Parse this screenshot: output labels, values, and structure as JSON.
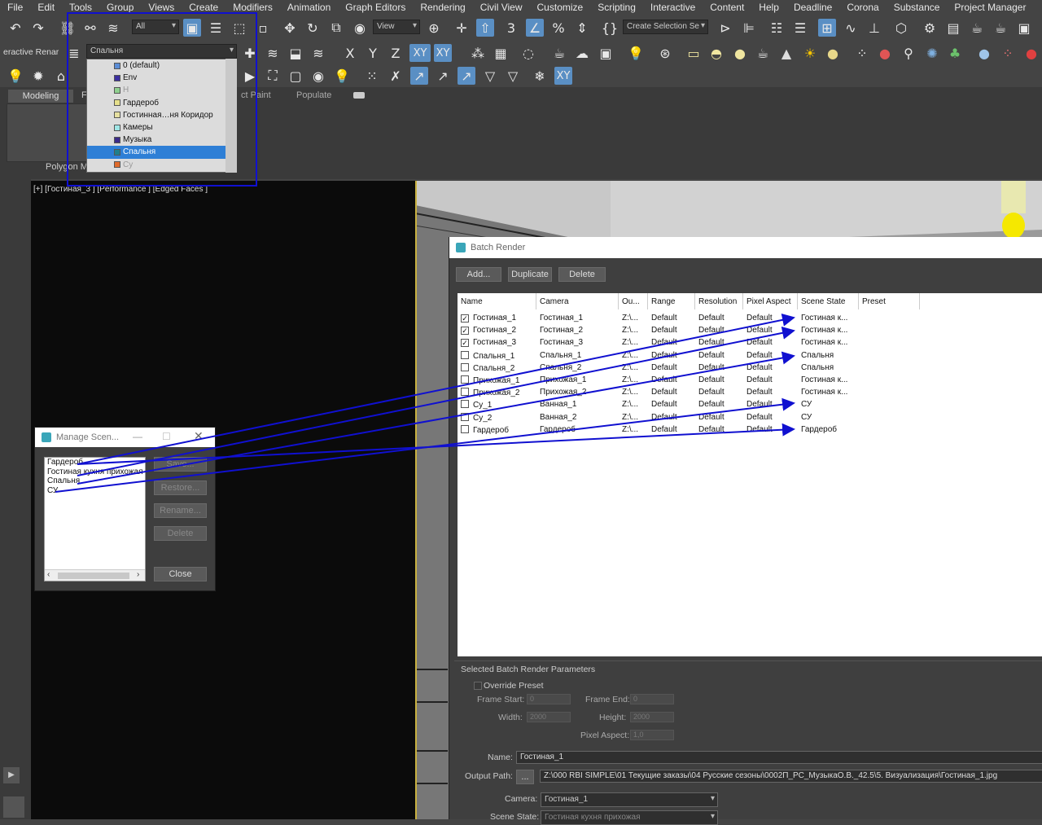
{
  "menu": [
    "File",
    "Edit",
    "Tools",
    "Group",
    "Views",
    "Create",
    "Modifiers",
    "Animation",
    "Graph Editors",
    "Rendering",
    "Civil View",
    "Customize",
    "Scripting",
    "Interactive",
    "Content",
    "Help",
    "Deadline",
    "Corona",
    "Substance",
    "Project Manager"
  ],
  "toolbar": {
    "filter": "All",
    "refcoord": "View",
    "selection_set": "Create Selection Se",
    "interactive_render": "eractive Renar",
    "axis": [
      "X",
      "Y",
      "Z",
      "XY",
      "XY"
    ]
  },
  "layer_combo": {
    "current": "Спальня"
  },
  "layers": [
    {
      "name": "0 (default)",
      "color": "#5b8dd6",
      "selected": false,
      "faded": false
    },
    {
      "name": "Env",
      "color": "#3b2fa0",
      "selected": false,
      "faded": false
    },
    {
      "name": "Н",
      "color": "#8fd08f",
      "selected": false,
      "faded": true
    },
    {
      "name": "Гардероб",
      "color": "#e6e08c",
      "selected": false,
      "faded": false
    },
    {
      "name": "Гостинная…ня Коридор",
      "color": "#e6e0a0",
      "selected": false,
      "faded": false
    },
    {
      "name": "Камеры",
      "color": "#9fe6e6",
      "selected": false,
      "faded": false
    },
    {
      "name": "Музыка",
      "color": "#3b2a8a",
      "selected": false,
      "faded": false
    },
    {
      "name": "Спальня",
      "color": "#1e7f8c",
      "selected": true,
      "faded": false
    },
    {
      "name": "Су",
      "color": "#e06a2a",
      "selected": false,
      "faded": true
    }
  ],
  "ribbon": {
    "tabs": [
      "Modeling",
      "F",
      "ct Paint",
      "Populate"
    ],
    "panel_label": "Polygon M"
  },
  "viewport_label": "[+] [Гостиная_3 ] [Performance ] [Edged Faces ]",
  "batch": {
    "title": "Batch Render",
    "buttons": {
      "add": "Add...",
      "duplicate": "Duplicate",
      "delete": "Delete"
    },
    "columns": [
      "Name",
      "Camera",
      "Ou...",
      "Range",
      "Resolution",
      "Pixel Aspect",
      "Scene State",
      "Preset"
    ],
    "rows": [
      {
        "checked": true,
        "name": "Гостиная_1",
        "camera": "Гостиная_1",
        "out": "Z:\\...",
        "range": "Default",
        "res": "Default",
        "aspect": "Default",
        "state": "Гостиная к..."
      },
      {
        "checked": true,
        "name": "Гостиная_2",
        "camera": "Гостиная_2",
        "out": "Z:\\...",
        "range": "Default",
        "res": "Default",
        "aspect": "Default",
        "state": "Гостиная к..."
      },
      {
        "checked": true,
        "name": "Гостиная_3",
        "camera": "Гостиная_3",
        "out": "Z:\\...",
        "range": "Default",
        "res": "Default",
        "aspect": "Default",
        "state": "Гостиная к..."
      },
      {
        "checked": false,
        "name": "Спальня_1",
        "camera": "Спальня_1",
        "out": "Z:\\...",
        "range": "Default",
        "res": "Default",
        "aspect": "Default",
        "state": "Спальня"
      },
      {
        "checked": false,
        "name": "Спальня_2",
        "camera": "Спальня_2",
        "out": "Z:\\...",
        "range": "Default",
        "res": "Default",
        "aspect": "Default",
        "state": "Спальня"
      },
      {
        "checked": false,
        "name": "Прихожая_1",
        "camera": "Прихожая_1",
        "out": "Z:\\...",
        "range": "Default",
        "res": "Default",
        "aspect": "Default",
        "state": "Гостиная к..."
      },
      {
        "checked": false,
        "name": "Прихожая_2",
        "camera": "Прихожая_2",
        "out": "Z:\\...",
        "range": "Default",
        "res": "Default",
        "aspect": "Default",
        "state": "Гостиная к..."
      },
      {
        "checked": false,
        "name": "Су_1",
        "camera": "Ванная_1",
        "out": "Z:\\...",
        "range": "Default",
        "res": "Default",
        "aspect": "Default",
        "state": "СУ"
      },
      {
        "checked": false,
        "name": "Су_2",
        "camera": "Ванная_2",
        "out": "Z:\\...",
        "range": "Default",
        "res": "Default",
        "aspect": "Default",
        "state": "СУ"
      },
      {
        "checked": false,
        "name": "Гардероб",
        "camera": "Гардероб",
        "out": "Z:\\...",
        "range": "Default",
        "res": "Default",
        "aspect": "Default",
        "state": "Гардероб"
      }
    ],
    "params": {
      "group_label": "Selected Batch Render Parameters",
      "override_preset": "Override Preset",
      "frame_start_label": "Frame Start:",
      "frame_start": "0",
      "frame_end_label": "Frame End:",
      "frame_end": "0",
      "width_label": "Width:",
      "width": "2000",
      "height_label": "Height:",
      "height": "2000",
      "pixel_aspect_label": "Pixel Aspect:",
      "pixel_aspect": "1,0",
      "name_label": "Name:",
      "name": "Гостиная_1",
      "output_label": "Output Path:",
      "browse": "...",
      "output_path": "Z:\\000 RBI SIMPLE\\01 Текущие заказы\\04 Русские сезоны\\0002П_РС_МузыкаО.В._42.5\\5. Визуализация\\Гостиная_1.jpg",
      "camera_label": "Camera:",
      "camera": "Гостиная_1",
      "scene_state_label": "Scene State:",
      "scene_state": "Гостиная кухня прихожая"
    }
  },
  "manage": {
    "title": "Manage Scen...",
    "states": [
      "Гардероб",
      "Гостиная кухня прихожая",
      "Спальня",
      "СУ"
    ],
    "buttons": {
      "save": "Save...",
      "restore": "Restore...",
      "rename": "Rename...",
      "delete": "Delete",
      "close": "Close"
    }
  },
  "colors": {
    "annotation": "#1010d0",
    "selection": "#2e7fd6",
    "accent_button": "#5a8fc4"
  }
}
